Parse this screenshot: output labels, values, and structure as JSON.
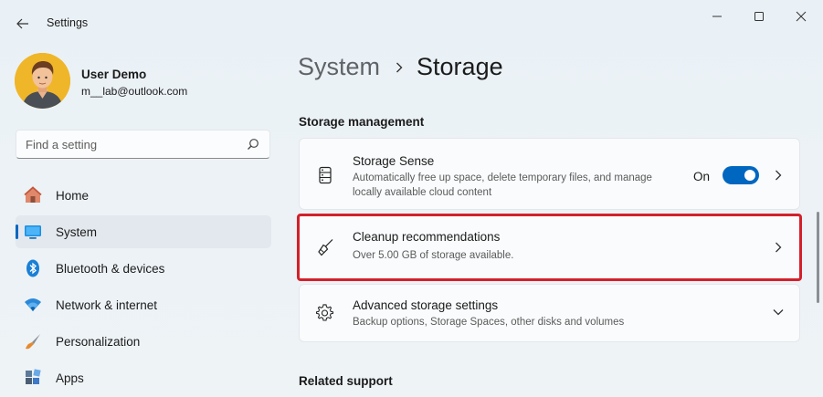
{
  "window": {
    "title": "Settings"
  },
  "profile": {
    "name": "User Demo",
    "email": "m__lab@outlook.com"
  },
  "search": {
    "placeholder": "Find a setting"
  },
  "nav": {
    "items": [
      {
        "label": "Home",
        "icon": "home-icon",
        "active": false
      },
      {
        "label": "System",
        "icon": "system-icon",
        "active": true
      },
      {
        "label": "Bluetooth & devices",
        "icon": "bluetooth-icon",
        "active": false
      },
      {
        "label": "Network & internet",
        "icon": "wifi-icon",
        "active": false
      },
      {
        "label": "Personalization",
        "icon": "brush-icon",
        "active": false
      },
      {
        "label": "Apps",
        "icon": "apps-icon",
        "active": false
      }
    ]
  },
  "breadcrumb": {
    "parent": "System",
    "current": "Storage"
  },
  "storage_management": {
    "title": "Storage management",
    "storage_sense": {
      "title": "Storage Sense",
      "desc_line1": "Automatically free up space, delete temporary files, and manage",
      "desc_line2": "locally available cloud content",
      "toggle_label": "On",
      "toggle_on": true
    },
    "cleanup": {
      "title": "Cleanup recommendations",
      "desc": "Over 5.00 GB of storage available."
    },
    "advanced": {
      "title": "Advanced storage settings",
      "desc": "Backup options, Storage Spaces, other disks and volumes"
    }
  },
  "related_support": {
    "title": "Related support"
  },
  "colors": {
    "accent": "#0067c0",
    "highlight": "#d3202a",
    "avatar_bg": "#f0b629"
  }
}
